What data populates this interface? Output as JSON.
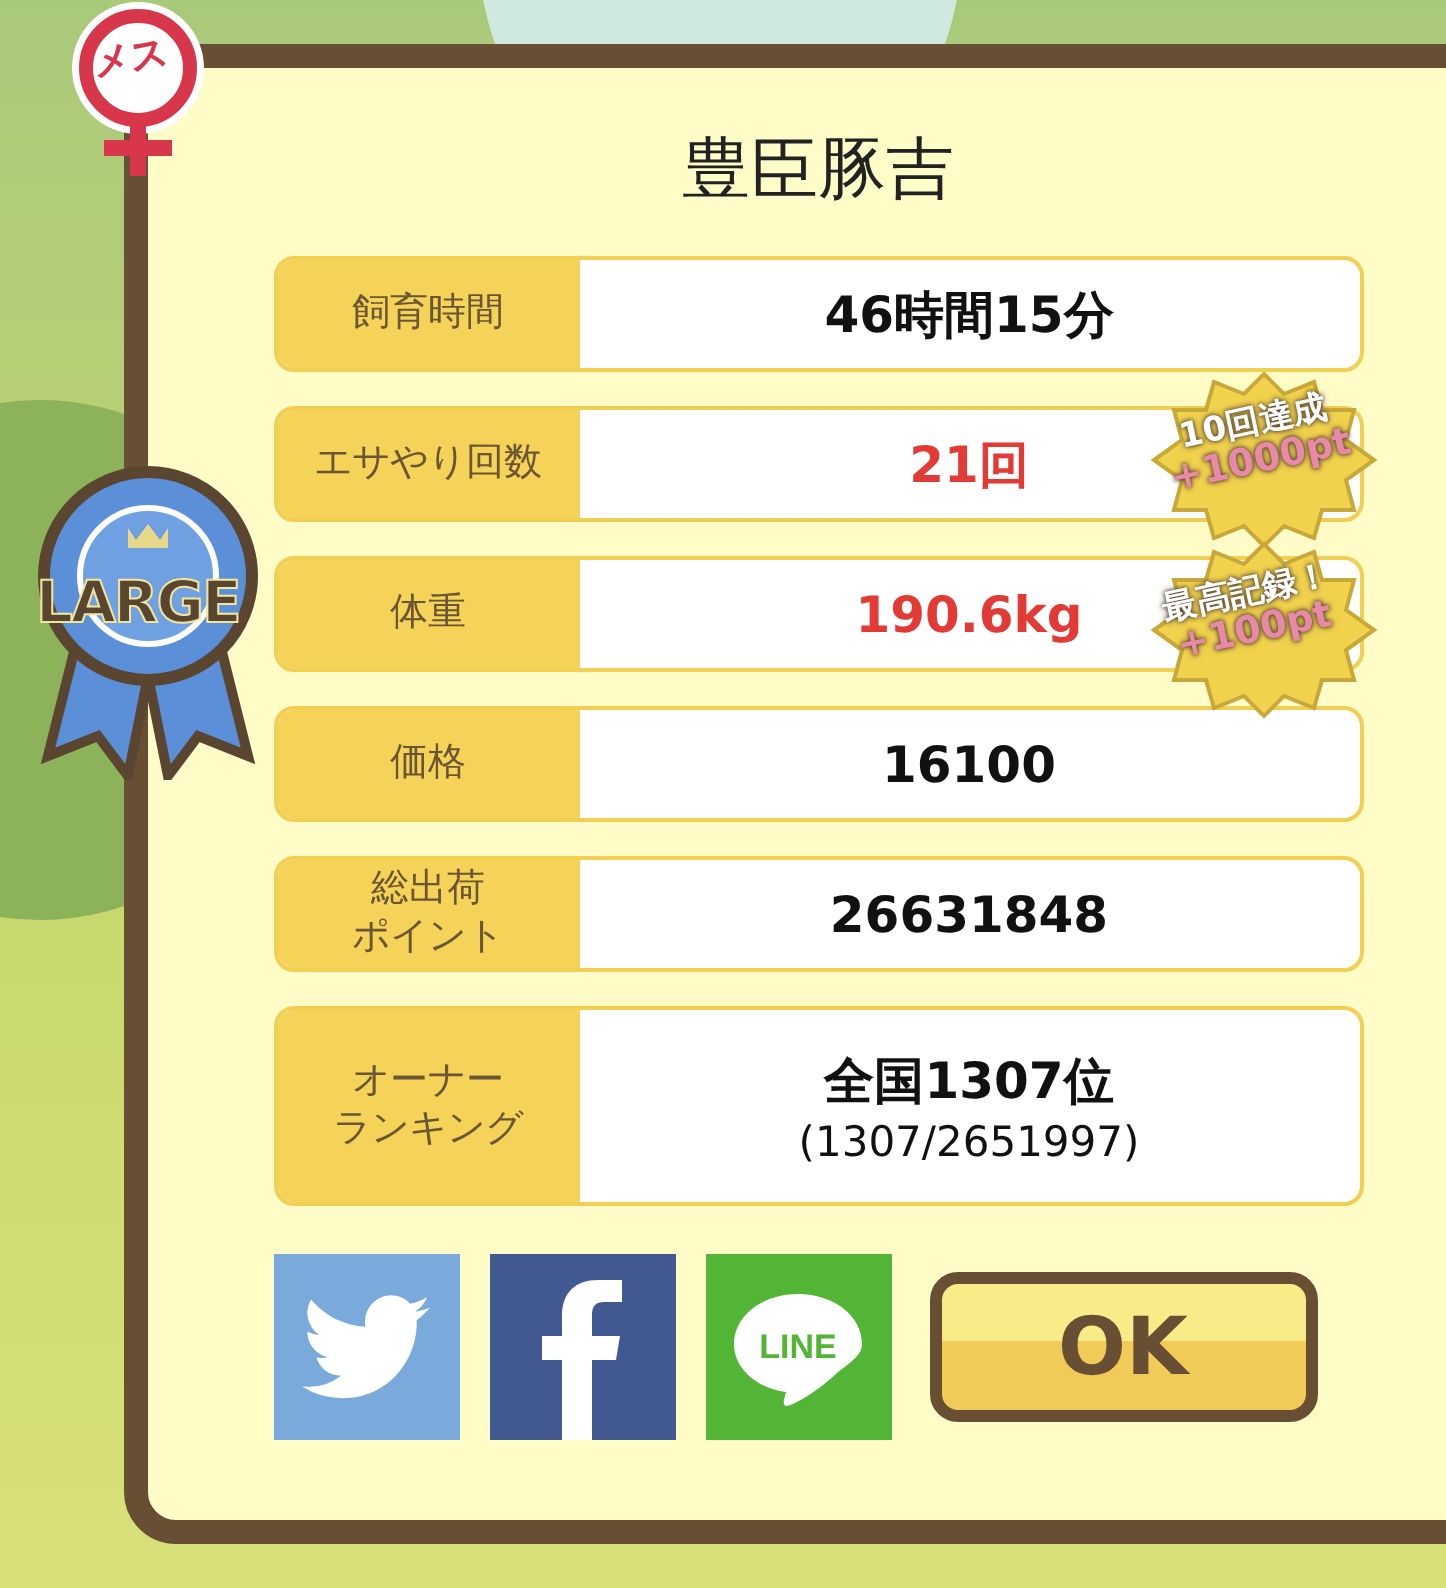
{
  "gender_badge": {
    "label": "メス"
  },
  "rank_ribbon": {
    "label": "LARGE"
  },
  "title": "豊臣豚吉",
  "stats": [
    {
      "label": [
        "飼育時間"
      ],
      "value": "46時間15分",
      "highlight": false
    },
    {
      "label": [
        "エサやり回数"
      ],
      "value": "21回",
      "highlight": true
    },
    {
      "label": [
        "体重"
      ],
      "value": "190.6kg",
      "highlight": true
    },
    {
      "label": [
        "価格"
      ],
      "value": "16100",
      "highlight": false
    },
    {
      "label": [
        "総出荷",
        "ポイント"
      ],
      "value": "26631848",
      "highlight": false
    },
    {
      "label": [
        "オーナー",
        "ランキング"
      ],
      "value": "全国1307位",
      "sub_value": "(1307/2651997)",
      "highlight": false
    }
  ],
  "bonus_badges": [
    {
      "title": "10回達成",
      "points": "+1000pt"
    },
    {
      "title": "最高記録！",
      "points": "+100pt"
    }
  ],
  "share_buttons": [
    {
      "kind": "twitter"
    },
    {
      "kind": "facebook"
    },
    {
      "kind": "line",
      "label": "LINE"
    }
  ],
  "ok_button": "OK"
}
